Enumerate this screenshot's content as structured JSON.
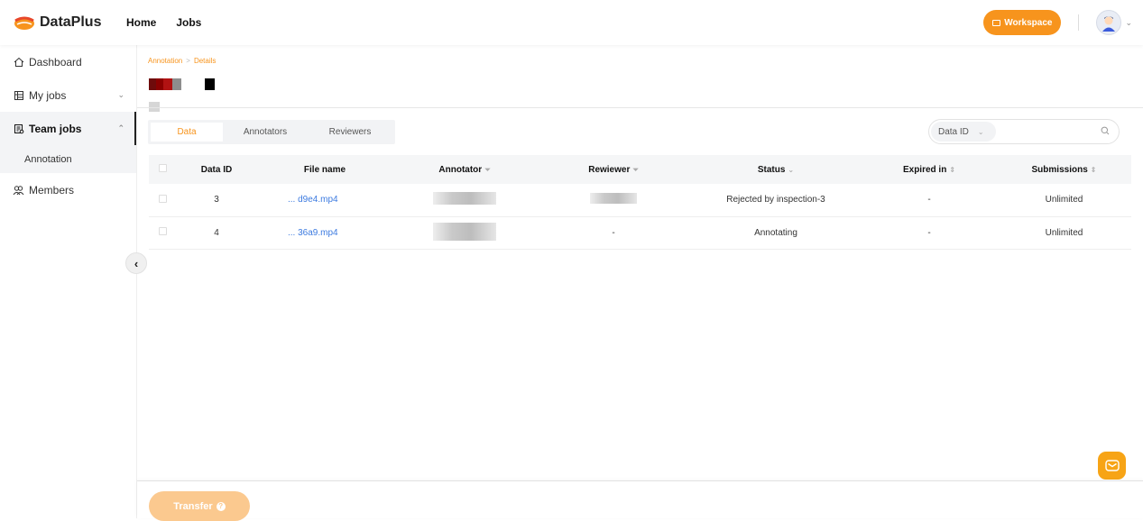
{
  "app": {
    "name": "DataPlus"
  },
  "topnav": {
    "home": "Home",
    "jobs": "Jobs"
  },
  "header": {
    "workspace_label": "Workspace"
  },
  "sidebar": {
    "items": [
      {
        "label": "Dashboard"
      },
      {
        "label": "My jobs"
      },
      {
        "label": "Team jobs"
      },
      {
        "label": "Members"
      }
    ],
    "sub_items": [
      {
        "label": "Annotation"
      }
    ]
  },
  "breadcrumb": {
    "parent": "Annotation",
    "separator": ">",
    "current": "Details"
  },
  "tabs": [
    {
      "label": "Data"
    },
    {
      "label": "Annotators"
    },
    {
      "label": "Reviewers"
    }
  ],
  "search": {
    "field": "Data ID",
    "placeholder": ""
  },
  "table": {
    "columns": {
      "data_id": "Data ID",
      "file_name": "File name",
      "annotator": "Annotator",
      "reviewer": "Rewiewer",
      "status": "Status",
      "expired_in": "Expired in",
      "submissions": "Submissions"
    },
    "rows": [
      {
        "data_id": "3",
        "file_name": "... d9e4.mp4",
        "reviewer": "",
        "status": "Rejected by inspection-3",
        "expired_in": "-",
        "submissions": "Unlimited"
      },
      {
        "data_id": "4",
        "file_name": "... 36a9.mp4",
        "reviewer": "-",
        "status": "Annotating",
        "expired_in": "-",
        "submissions": "Unlimited"
      }
    ]
  },
  "footer": {
    "transfer_label": "Transfer"
  },
  "colors": {
    "accent": "#f7941d",
    "link": "#3d7be0",
    "transfer_disabled": "#fbc98f"
  }
}
